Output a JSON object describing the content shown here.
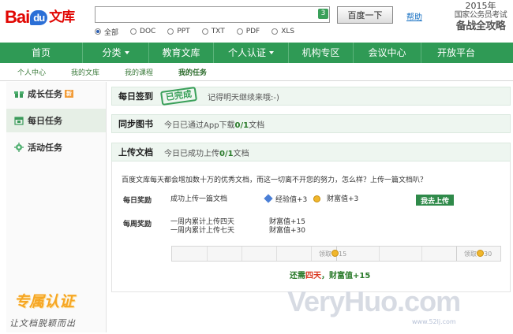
{
  "header": {
    "logo_left": "Bai",
    "logo_du": "du",
    "logo_right": "文库",
    "search_value": "",
    "count_badge": "3",
    "search_button": "百度一下",
    "help": "帮助",
    "promo": {
      "year": "2015年",
      "line1": "国家公务员考试",
      "line2": "备战全攻略"
    }
  },
  "filters": [
    {
      "label": "全部",
      "selected": true
    },
    {
      "label": "DOC",
      "selected": false
    },
    {
      "label": "PPT",
      "selected": false
    },
    {
      "label": "TXT",
      "selected": false
    },
    {
      "label": "PDF",
      "selected": false
    },
    {
      "label": "XLS",
      "selected": false
    }
  ],
  "nav": [
    {
      "label": "首页"
    },
    {
      "label": "分类"
    },
    {
      "label": "教育文库"
    },
    {
      "label": "个人认证"
    },
    {
      "label": "机构专区"
    },
    {
      "label": "会议中心"
    },
    {
      "label": "开放平台"
    }
  ],
  "subnav": [
    "个人中心",
    "我的文库",
    "我的课程",
    "我的任务"
  ],
  "sidebar": {
    "items": [
      {
        "label": "成长任务",
        "badge": "新"
      },
      {
        "label": "每日任务"
      },
      {
        "label": "活动任务"
      }
    ],
    "stamp_title": "专属认证",
    "stamp_sub": "让文档脱颖而出"
  },
  "tasks": {
    "checkin": {
      "title": "每日签到",
      "stamp": "已完成",
      "desc": "记得明天继续来哦:-)"
    },
    "sync": {
      "title": "同步图书",
      "desc_pre": "今日已通过App下载",
      "count": "0/1",
      "desc_post": "文档"
    },
    "upload": {
      "title": "上传文档",
      "desc_pre": "今日已成功上传",
      "count": "0/1",
      "desc_post": "文档"
    }
  },
  "upload_panel": {
    "intro": "百度文库每天都会增加数十万的优秀文档，而这一切离不开您的努力，怎么样？上传一篇文档叭？",
    "daily_label": "每日奖励",
    "daily_task": "成功上传一篇文档",
    "daily_exp": "经验值+3",
    "daily_wealth": "财富值+3",
    "upload_button": "我去上传",
    "weekly_label": "每周奖励",
    "weekly_task1": "一周内累计上传四天",
    "weekly_task2": "一周内累计上传七天",
    "weekly_wealth1": "财富值+15",
    "weekly_wealth2": "财富值+30",
    "claim1": "领取",
    "claim1_value": "15",
    "claim2": "领取",
    "claim2_value": "30",
    "need_pre": "还需",
    "need_days": "四天",
    "need_post": "，财富值+15"
  },
  "watermark": {
    "big": "VeryHuo.com",
    "small": "www.52lj.com"
  }
}
